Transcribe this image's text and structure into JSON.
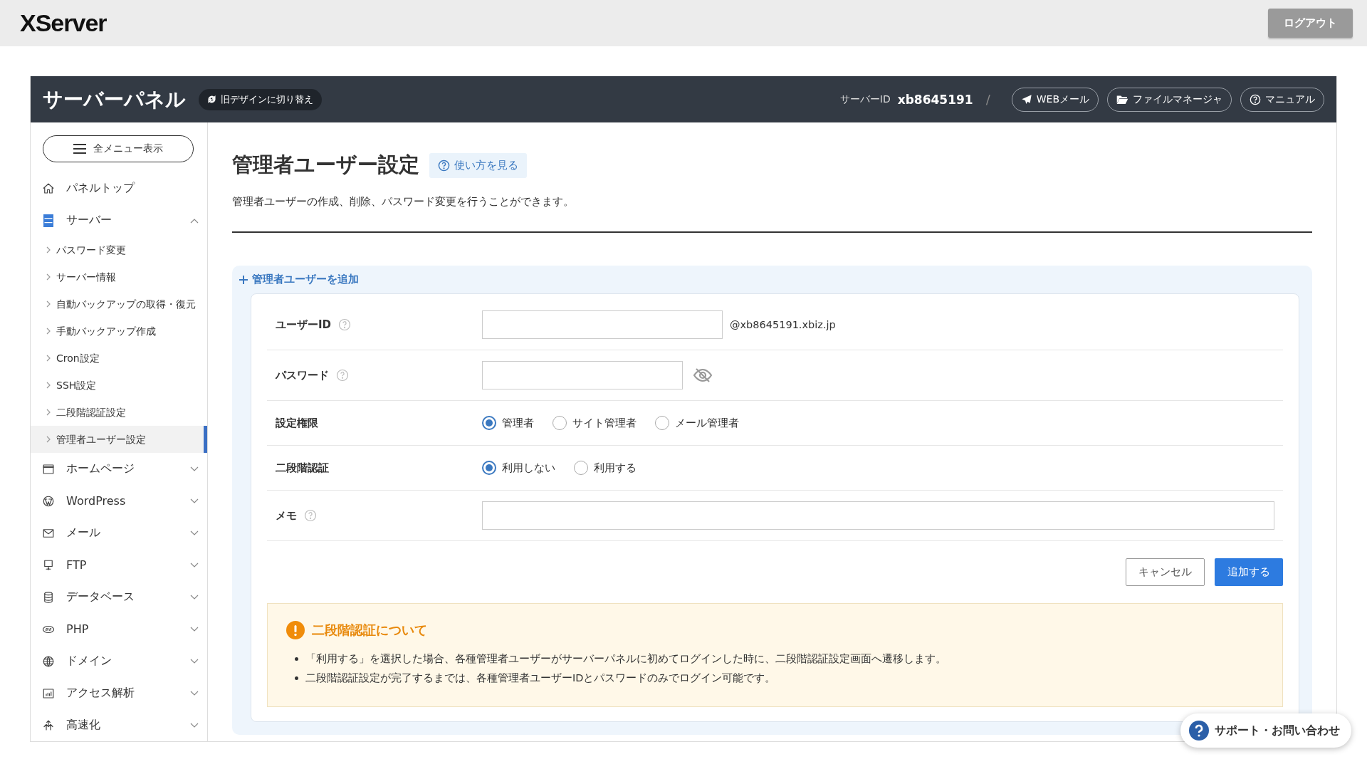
{
  "topbar": {
    "logo": "XServer",
    "logout": "ログアウト"
  },
  "header": {
    "title": "サーバーパネル",
    "switch_design": "旧デザインに切り替え",
    "server_id_label": "サーバーID",
    "server_id": "xb8645191",
    "separator": "/",
    "buttons": [
      {
        "kind": "mail",
        "label": "WEBメール"
      },
      {
        "kind": "folder",
        "label": "ファイルマネージャ"
      },
      {
        "kind": "help",
        "label": "マニュアル"
      }
    ]
  },
  "sidebar": {
    "menu_button": "全メニュー表示",
    "items": [
      {
        "kind": "home",
        "label": "パネルトップ"
      },
      {
        "kind": "server",
        "label": "サーバー",
        "expanded": true,
        "children": [
          {
            "label": "パスワード変更",
            "selected": false
          },
          {
            "label": "サーバー情報",
            "selected": false
          },
          {
            "label": "自動バックアップの取得・復元",
            "selected": false
          },
          {
            "label": "手動バックアップ作成",
            "selected": false
          },
          {
            "label": "Cron設定",
            "selected": false
          },
          {
            "label": "SSH設定",
            "selected": false
          },
          {
            "label": "二段階認証設定",
            "selected": false
          },
          {
            "label": "管理者ユーザー設定",
            "selected": true
          }
        ]
      },
      {
        "kind": "browser",
        "label": "ホームページ",
        "expanded": false
      },
      {
        "kind": "wordpress",
        "label": "WordPress",
        "expanded": false
      },
      {
        "kind": "mail",
        "label": "メール",
        "expanded": false
      },
      {
        "kind": "ftp",
        "label": "FTP",
        "expanded": false
      },
      {
        "kind": "database",
        "label": "データベース",
        "expanded": false
      },
      {
        "kind": "php",
        "label": "PHP",
        "expanded": false
      },
      {
        "kind": "globe",
        "label": "ドメイン",
        "expanded": false
      },
      {
        "kind": "chart",
        "label": "アクセス解析",
        "expanded": false
      },
      {
        "kind": "speed",
        "label": "高速化",
        "expanded": false
      }
    ]
  },
  "page": {
    "title": "管理者ユーザー設定",
    "help_link": "使い方を見る",
    "description": "管理者ユーザーの作成、削除、パスワード変更を行うことができます。"
  },
  "form": {
    "toggle": "管理者ユーザーを追加",
    "fields": [
      {
        "kind": "text",
        "label": "ユーザーID",
        "help": true,
        "suffix": "@xb8645191.xbiz.jp"
      },
      {
        "kind": "password",
        "label": "パスワード",
        "help": true
      },
      {
        "kind": "radio",
        "label": "設定権限",
        "help": false,
        "options": [
          {
            "label": "管理者",
            "selected": true
          },
          {
            "label": "サイト管理者",
            "selected": false
          },
          {
            "label": "メール管理者",
            "selected": false
          }
        ]
      },
      {
        "kind": "radio",
        "label": "二段階認証",
        "help": false,
        "options": [
          {
            "label": "利用しない",
            "selected": true
          },
          {
            "label": "利用する",
            "selected": false
          }
        ]
      },
      {
        "kind": "wide",
        "label": "メモ",
        "help": true
      }
    ],
    "cancel": "キャンセル",
    "submit": "追加する",
    "notice": {
      "title": "二段階認証について",
      "items": [
        "「利用する」を選択した場合、各種管理者ユーザーがサーバーパネルに初めてログインした時に、二段階認証設定画面へ遷移します。",
        "二段階認証設定が完了するまでは、各種管理者ユーザーIDとパスワードのみでログイン可能です。"
      ]
    }
  },
  "support": "サポート・お問い合わせ"
}
